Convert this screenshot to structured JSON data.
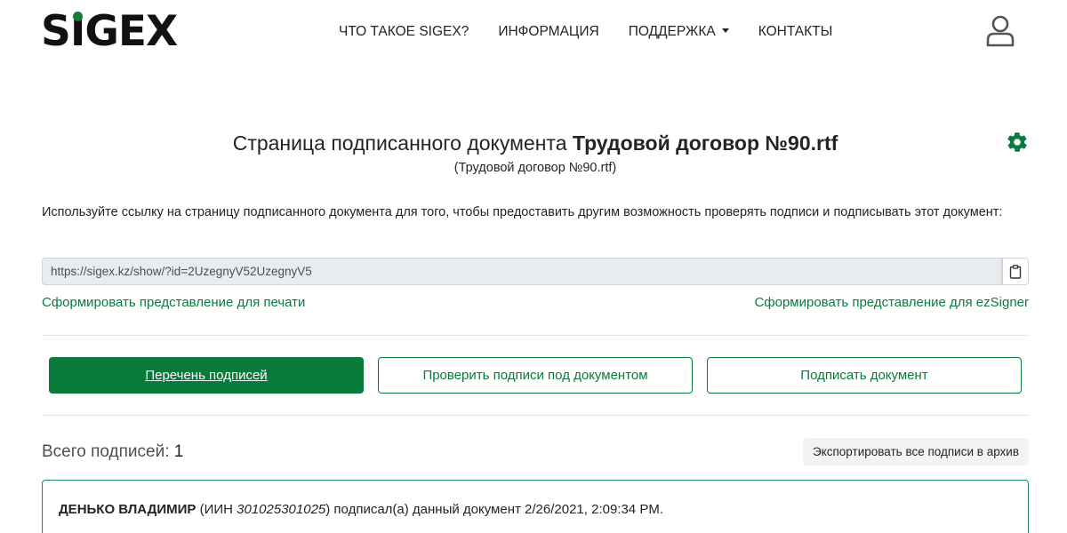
{
  "header": {
    "logo_text_before": "S",
    "logo_text_i": "I",
    "logo_text_after": "GEX",
    "nav": {
      "what_is": "ЧТО ТАКОЕ SIGEX?",
      "info": "ИНФОРМАЦИЯ",
      "support": "ПОДДЕРЖКА",
      "contacts": "КОНТАКТЫ"
    },
    "user_icon": "user-icon"
  },
  "document": {
    "title_prefix": "Страница подписанного документа ",
    "title_name": "Трудовой договор №90.rtf",
    "subtitle": "(Трудовой договор №90.rtf)",
    "settings_icon": "gear-icon"
  },
  "share": {
    "description": "Используйте ссылку на страницу подписанного документа для того, чтобы предоставить другим возможность проверять подписи и подписывать этот документ:",
    "url": "https://sigex.kz/show/?id=2UzegnyV52UzegnyV5",
    "copy_icon": "clipboard-icon",
    "print_link": "Сформировать представление для печати",
    "ezsigner_link": "Сформировать представление для ezSigner"
  },
  "actions": {
    "signatures_list": "Перечень подписей",
    "verify": "Проверить подписи под документом",
    "sign": "Подписать документ"
  },
  "signatures": {
    "total_label": "Всего подписей: ",
    "total_count": "1",
    "export_button": "Экспортировать все подписи в архив",
    "items": [
      {
        "name": "ДЕНЬКО ВЛАДИМИР",
        "iin_prefix": " (ИИН ",
        "iin": "301025301025",
        "suffix": ") подписал(а) данный документ 2/26/2021, 2:09:34 PM."
      }
    ]
  },
  "colors": {
    "brand_green": "#087b3b",
    "link_green": "#0b7a3e"
  }
}
